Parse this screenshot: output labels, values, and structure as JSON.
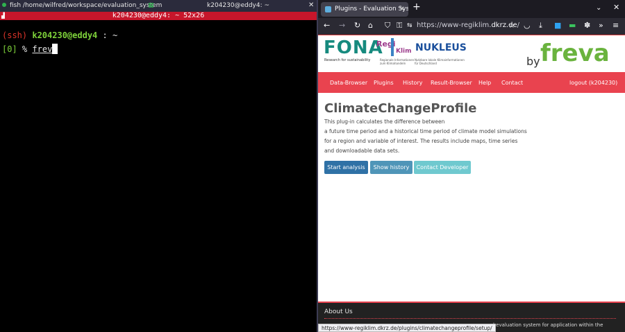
{
  "terminal": {
    "title_left": "fish /home/wilfred/workspace/evaluation_system",
    "title_right": "k204230@eddy4: ~",
    "status_bar": "k204230@eddy4: ~ 52x26",
    "prompt_ssh": "(ssh)",
    "prompt_user": "k204230@eddy4",
    "prompt_sep": ":",
    "prompt_cwd": "~",
    "exit_code": "[0]",
    "prompt_symbol": "%",
    "command": "frev"
  },
  "browser": {
    "tab_title": "Plugins - Evaluation Syste",
    "url_prefix": "https://www-regiklim.",
    "url_domain": "dkrz.de",
    "url_suffix": "/",
    "status_url": "https://www-regiklim.dkrz.de/plugins/climatechangeprofile/setup/"
  },
  "header": {
    "fona": "FONA",
    "fona_sub": "Research for sustainability",
    "regi": "Regi",
    "klim": "Klim",
    "regi_sub1": "Regionale Informationen",
    "regi_sub2": "zum Klimahandeln",
    "nukleus": "NUKLEUS",
    "nukleus_sub1": "Nutzbare lokale Klimainformationen",
    "nukleus_sub2": "für Deutschland",
    "by": "by",
    "freva": "freva"
  },
  "menu": {
    "items": [
      "Data-Browser",
      "Plugins",
      "History",
      "Result-Browser",
      "Help",
      "Contact"
    ],
    "logout": "logout (k204230)"
  },
  "main": {
    "title": "ClimateChangeProfile",
    "desc": [
      "This plug-in calculates the difference between",
      "a future time period and a historical time period of climate model simulations",
      "for a region and variable of interest. The results include maps, time series",
      "and downloadable data sets."
    ],
    "btn_start": "Start analysis",
    "btn_history": "Show history",
    "btn_contact": "Contact Developer"
  },
  "about": {
    "heading": "About Us",
    "text": "l evaluation system for application within the"
  },
  "colors": {
    "menu_red": "#e9434f",
    "start_blue": "#2f71a6",
    "freva_green": "#6ab33e"
  }
}
